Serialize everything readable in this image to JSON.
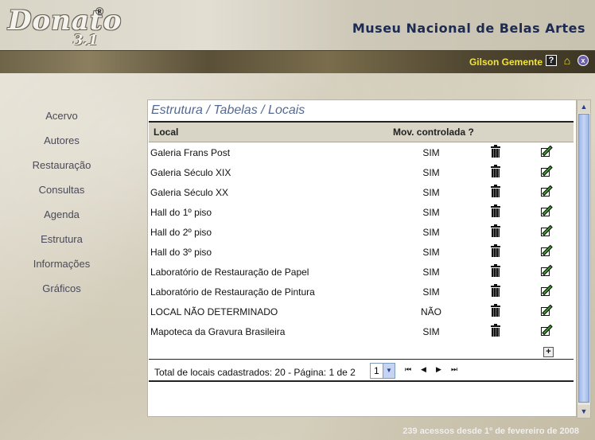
{
  "header": {
    "logo_text": "Donato",
    "logo_registered": "®",
    "logo_version": "3.1",
    "museum_name": "Museu Nacional de Belas Artes"
  },
  "userbar": {
    "username": "Gilson Gemente",
    "help_symbol": "?",
    "home_symbol": "⌂",
    "exit_symbol": "x"
  },
  "nav": {
    "items": [
      {
        "label": "Acervo"
      },
      {
        "label": "Autores"
      },
      {
        "label": "Restauração"
      },
      {
        "label": "Consultas"
      },
      {
        "label": "Agenda"
      },
      {
        "label": "Estrutura"
      },
      {
        "label": "Informações"
      },
      {
        "label": "Gráficos"
      }
    ]
  },
  "panel": {
    "breadcrumb": "Estrutura / Tabelas / Locais",
    "columns": {
      "local": "Local",
      "mov": "Mov. controlada ?"
    },
    "rows": [
      {
        "local": "Galeria Frans Post",
        "mov": "SIM"
      },
      {
        "local": "Galeria Século XIX",
        "mov": "SIM"
      },
      {
        "local": "Galeria Século XX",
        "mov": "SIM"
      },
      {
        "local": "Hall do 1º piso",
        "mov": "SIM"
      },
      {
        "local": "Hall do 2º piso",
        "mov": "SIM"
      },
      {
        "local": "Hall do 3º piso",
        "mov": "SIM"
      },
      {
        "local": "Laboratório de Restauração de Papel",
        "mov": "SIM"
      },
      {
        "local": "Laboratório de Restauração de Pintura",
        "mov": "SIM"
      },
      {
        "local": "LOCAL NÃO DETERMINADO",
        "mov": "NÃO"
      },
      {
        "local": "Mapoteca da Gravura Brasileira",
        "mov": "SIM"
      }
    ],
    "add_symbol": "+",
    "footer_text": "Total de locais cadastrados: 20 - Página: 1 de 2",
    "page_selected": "1",
    "nav_first": "⏮",
    "nav_prev": "◀",
    "nav_next": "▶",
    "nav_last": "⏭"
  },
  "footer_note": "239 acessos desde 1º de fevereiro de 2008",
  "colors": {
    "museum_title": "#1d2a52",
    "username": "#f2e43a",
    "breadcrumb": "#556a92"
  }
}
